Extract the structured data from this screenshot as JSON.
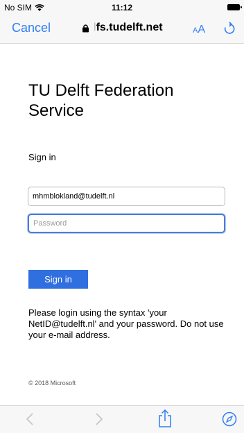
{
  "status_bar": {
    "carrier": "No SIM",
    "time": "11:12"
  },
  "nav_bar": {
    "cancel_label": "Cancel",
    "url_faded": "l",
    "url_domain": "fs.tudelft.net",
    "text_size_small": "A",
    "text_size_large": "A"
  },
  "page": {
    "title": "TU Delft Federation Service",
    "sign_in_heading": "Sign in",
    "email_value": "mhmblokland@tudelft.nl",
    "password_placeholder": "Password",
    "sign_in_button": "Sign in",
    "help_text": "Please login using the syntax 'your NetID@tudelft.nl' and your password. Do not use your e-mail address.",
    "copyright": "© 2018 Microsoft"
  },
  "colors": {
    "accent": "#2f7ff3",
    "button": "#2f6fe0",
    "focus_border": "#4a7fd4"
  },
  "icons": [
    "wifi-icon",
    "battery-icon",
    "lock-icon",
    "reload-icon",
    "back-icon",
    "forward-icon",
    "share-icon",
    "compass-icon"
  ]
}
